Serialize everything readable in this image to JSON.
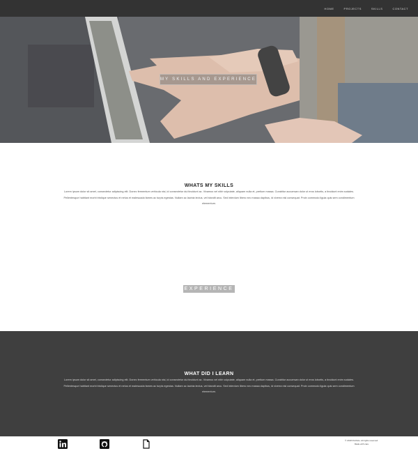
{
  "nav": {
    "links": [
      "HOME",
      "PROJECTS",
      "SKILLS",
      "CONTACT"
    ]
  },
  "hero": {
    "banner_text": "MY SKILLS AND EXPERIENCE"
  },
  "skills": {
    "title": "WHATS MY SKILLS",
    "body": "Lorem ipsum dolor sit amet, consectetur adipiscing elit. Donec fermentum vehicula nisi, id consectetur dui tincidunt ac. Vivamus vel nibh vulputate, aliquam nulla et, pretium massa. Curabitur accumsan dolor ut eros lobortis, a tincidunt enim sodales. Pellentesque habitant morbi tristique senectus et netus et malesuada fames ac turpis egestas. Nullam ac lacinia lectus, vel blandit arcu. Sed interdum libero nec massa dapibus, id viverra nisl consequat. Proin commodo ligula quis sem condimentum elementum."
  },
  "experience": {
    "label": "EXPERIENCE"
  },
  "learn": {
    "title": "WHAT DID I LEARN",
    "body": "Lorem ipsum dolor sit amet, consectetur adipiscing elit. Donec fermentum vehicula nisi, id consectetur dui tincidunt ac. Vivamus vel nibh vulputate, aliquam nulla et, pretium massa. Curabitur accumsan dolor ut eros lobortis, a tincidunt enim sodales. Pellentesque habitant morbi tristique senectus et netus et malesuada fames ac turpis egestas. Nullam ac lacinia lectus, vel blandit arcu. Sed interdum libero nec massa dapibus, id viverra nisl consequat. Proin commodo ligula quis sem condimentum elementum."
  },
  "footer": {
    "icons": [
      "linkedin-icon",
      "github-icon",
      "document-icon"
    ],
    "credit_line1": "© 2018 Portfolio. All rights reserved.",
    "credit_line2": "Made with care"
  },
  "colors": {
    "nav_bg": "#333333",
    "dark_section_bg": "#3f3f3f",
    "badge_bg": "#b5b5b5"
  }
}
